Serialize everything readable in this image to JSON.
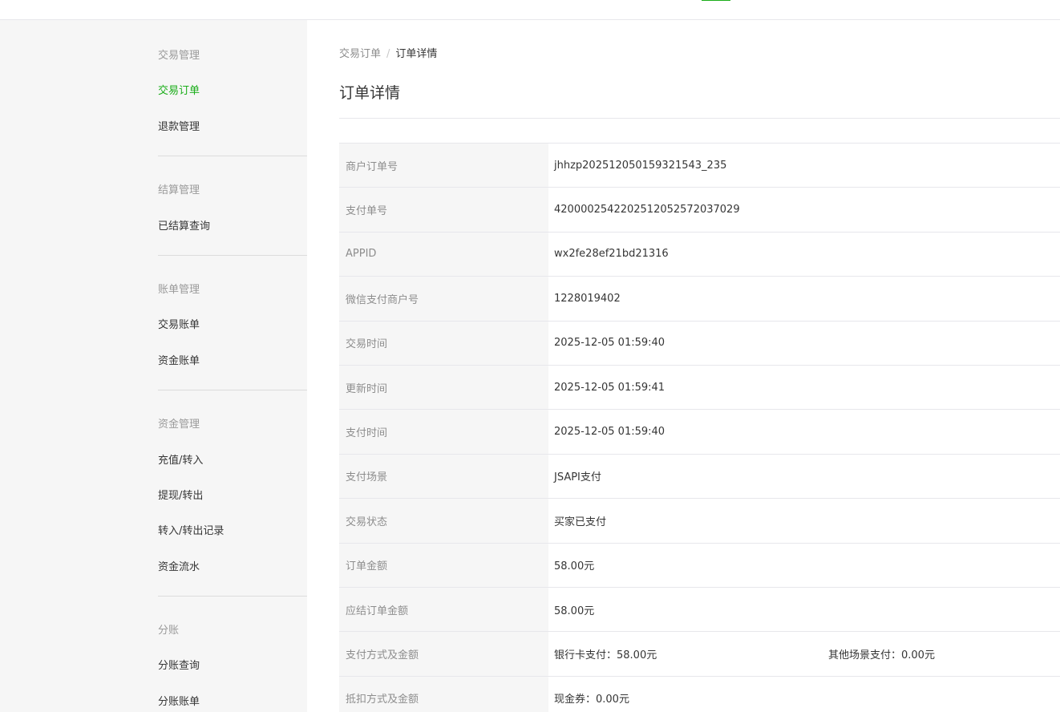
{
  "sidebar": {
    "groups": [
      {
        "title": "交易管理",
        "items": [
          {
            "label": "交易订单",
            "active": true
          },
          {
            "label": "退款管理"
          }
        ]
      },
      {
        "title": "结算管理",
        "items": [
          {
            "label": "已结算查询"
          }
        ]
      },
      {
        "title": "账单管理",
        "items": [
          {
            "label": "交易账单"
          },
          {
            "label": "资金账单"
          }
        ]
      },
      {
        "title": "资金管理",
        "items": [
          {
            "label": "充值/转入"
          },
          {
            "label": "提现/转出"
          },
          {
            "label": "转入/转出记录"
          },
          {
            "label": "资金流水"
          }
        ]
      },
      {
        "title": "分账",
        "items": [
          {
            "label": "分账查询"
          },
          {
            "label": "分账账单"
          }
        ]
      }
    ]
  },
  "breadcrumb": {
    "parent": "交易订单",
    "separator": "/",
    "current": "订单详情"
  },
  "page_title": "订单详情",
  "details": [
    {
      "label": "商户订单号",
      "value": "jhhzp202512050159321543_235"
    },
    {
      "label": "支付单号",
      "value": "4200002542202512052572037029"
    },
    {
      "label": "APPID",
      "value": "wx2fe28ef21bd21316"
    },
    {
      "label": "微信支付商户号",
      "value": "1228019402"
    },
    {
      "label": "交易时间",
      "value": "2025-12-05 01:59:40"
    },
    {
      "label": "更新时间",
      "value": "2025-12-05 01:59:41"
    },
    {
      "label": "支付时间",
      "value": "2025-12-05 01:59:40"
    },
    {
      "label": "支付场景",
      "value": "JSAPI支付"
    },
    {
      "label": "交易状态",
      "value": "买家已支付"
    },
    {
      "label": "订单金额",
      "value": "58.00元"
    },
    {
      "label": "应结订单金额",
      "value": "58.00元"
    },
    {
      "label": "支付方式及金额",
      "value": "银行卡支付：58.00元",
      "value2": "其他场景支付：0.00元"
    },
    {
      "label": "抵扣方式及金额",
      "value": "现金券：0.00元"
    }
  ],
  "colors": {
    "accent": "#1aad19",
    "sidebar_bg": "#f6f6f6",
    "label_bg": "#f6f6f6",
    "border": "#e7e7eb"
  }
}
